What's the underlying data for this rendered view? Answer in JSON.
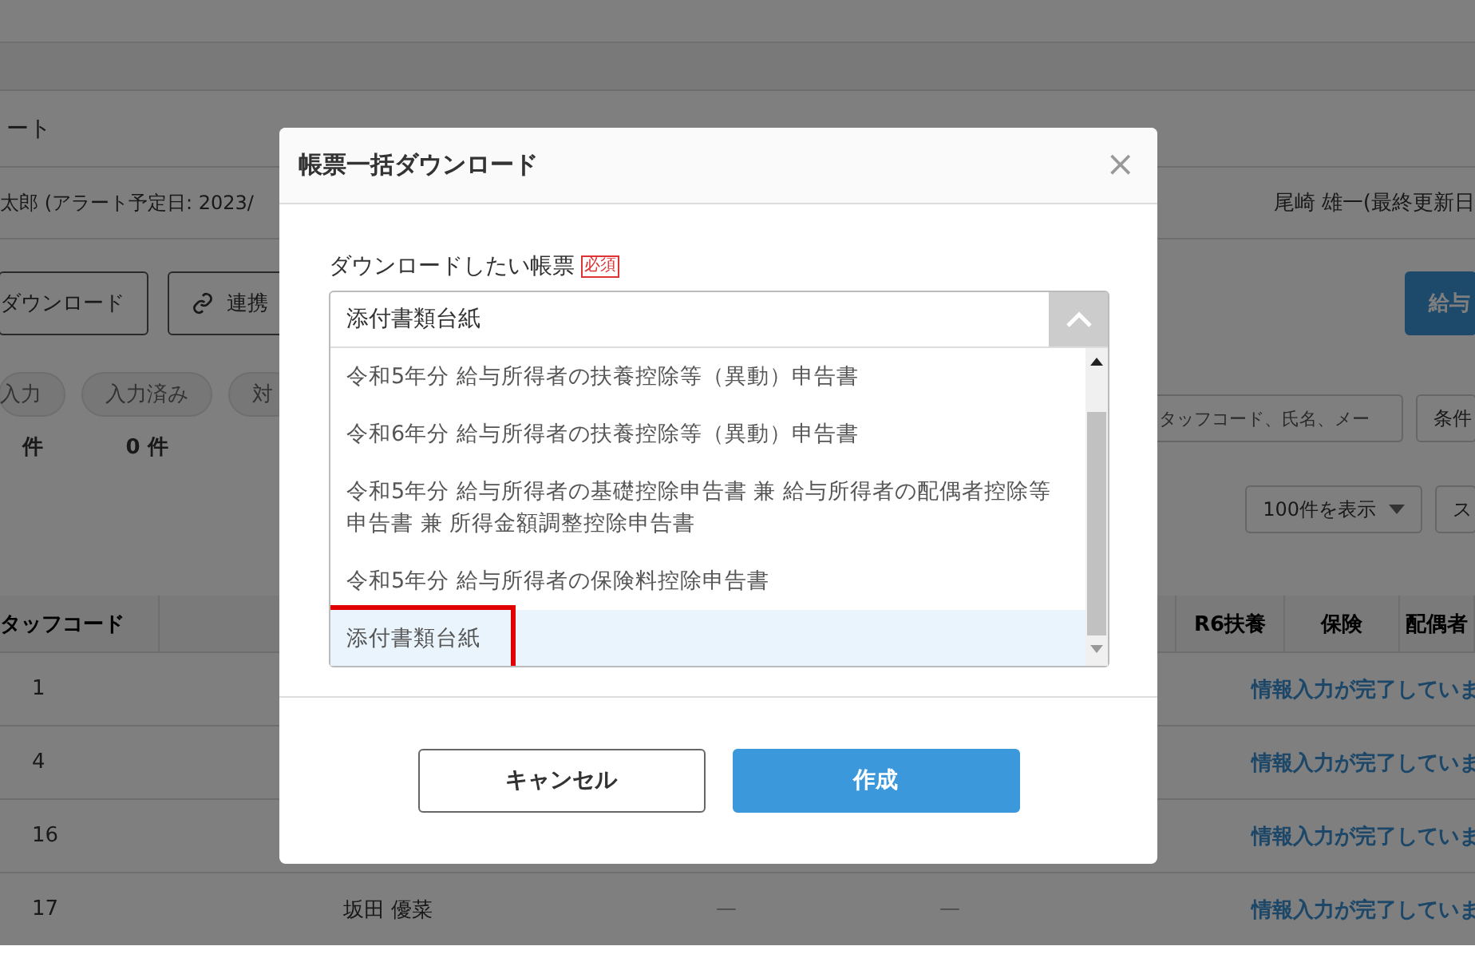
{
  "page": {
    "heading": "ート",
    "alert_line": "太郎 (アラート予定日: 2023/",
    "updated_by": "尾崎 雄一(最終更新日",
    "buttons": [
      {
        "label": "ダウンロード",
        "kind": "outline"
      },
      {
        "label": "連携",
        "kind": "link"
      },
      {
        "label": "給与",
        "kind": "primary"
      }
    ],
    "status_tabs": [
      {
        "label": "入力",
        "count": "件"
      },
      {
        "label": "入力済み",
        "count": "0 件"
      },
      {
        "label": "対"
      }
    ],
    "search": {
      "placeholder": "タッフコード、氏名、メー"
    },
    "filter_button": "条件",
    "page_size": "100件を表示",
    "sort_button": "ス",
    "table": {
      "columns": [
        "タッフコード",
        "R6扶養",
        "保険",
        "配偶者"
      ],
      "rows": [
        {
          "code": "1",
          "status": "情報入力が完了していま"
        },
        {
          "code": "4",
          "status": "情報入力が完了していま"
        },
        {
          "code": "16",
          "status": "情報入力が完了していま"
        },
        {
          "code": "17",
          "name": "坂田 優菜",
          "col_a": "—",
          "col_b": "—",
          "status": "情報入力が完了していま"
        }
      ]
    }
  },
  "dialog": {
    "title": "帳票一括ダウンロード",
    "close": "×",
    "field_label": "ダウンロードしたい帳票",
    "required_badge": "必須",
    "select": {
      "value": "添付書類台紙",
      "expanded": true,
      "options": [
        {
          "label": "令和5年分 給与所得者の扶養控除等（異動）申告書",
          "selected": false,
          "highlighted": false
        },
        {
          "label": "令和6年分 給与所得者の扶養控除等（異動）申告書",
          "selected": false,
          "highlighted": false
        },
        {
          "label": "令和5年分 給与所得者の基礎控除申告書 兼 給与所得者の配偶者控除等申告書 兼 所得金額調整控除申告書",
          "selected": false,
          "highlighted": false
        },
        {
          "label": "令和5年分 給与所得者の保険料控除申告書",
          "selected": false,
          "highlighted": false
        },
        {
          "label": "添付書類台紙",
          "selected": true,
          "highlighted": true
        }
      ]
    },
    "cancel": "キャンセル",
    "submit": "作成"
  }
}
